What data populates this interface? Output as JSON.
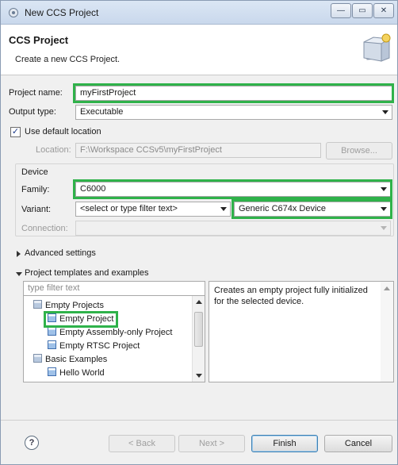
{
  "window": {
    "title": "New CCS Project",
    "minimize_glyph": "—",
    "maximize_glyph": "▭",
    "close_glyph": "✕"
  },
  "header": {
    "title": "CCS Project",
    "description": "Create a new CCS Project."
  },
  "form": {
    "project_name_label": "Project name:",
    "project_name_value": "myFirstProject",
    "output_type_label": "Output type:",
    "output_type_value": "Executable",
    "use_default_location_label": "Use default location",
    "use_default_location_checked": true,
    "check_glyph": "✓",
    "location_label": "Location:",
    "location_value": "F:\\Workspace CCSv5\\myFirstProject",
    "browse_label": "Browse..."
  },
  "device": {
    "group_label": "Device",
    "family_label": "Family:",
    "family_value": "C6000",
    "variant_label": "Variant:",
    "variant_filter_value": "<select or type filter text>",
    "variant_value": "Generic C674x Device",
    "connection_label": "Connection:",
    "connection_value": ""
  },
  "advanced_settings_label": "Advanced settings",
  "templates": {
    "section_label": "Project templates and examples",
    "filter_placeholder": "type filter text",
    "items": [
      {
        "label": "Empty Projects",
        "kind": "folder"
      },
      {
        "label": "Empty Project",
        "kind": "project"
      },
      {
        "label": "Empty Assembly-only Project",
        "kind": "project"
      },
      {
        "label": "Empty RTSC Project",
        "kind": "project"
      },
      {
        "label": "Basic Examples",
        "kind": "folder"
      },
      {
        "label": "Hello World",
        "kind": "project"
      }
    ],
    "description": "Creates an empty project fully initialized for the selected device."
  },
  "buttons": {
    "help_glyph": "?",
    "back": "< Back",
    "next": "Next >",
    "finish": "Finish",
    "cancel": "Cancel"
  },
  "colors": {
    "highlight": "#2fb24a",
    "title_bar": "#dbe6f4",
    "default_button_border": "#3c7fb1"
  }
}
